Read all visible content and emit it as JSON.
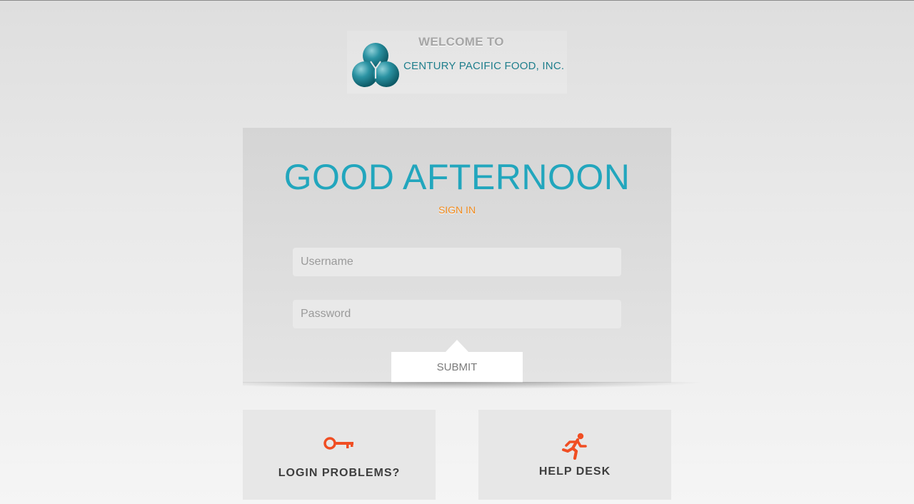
{
  "logo": {
    "welcome": "WELCOME TO",
    "company": "CENTURY PACIFIC FOOD, INC.",
    "icon": "three-circles-logo"
  },
  "login": {
    "greeting": "GOOD AFTERNOON",
    "sign_in": "SIGN IN",
    "username_placeholder": "Username",
    "username_value": "",
    "password_placeholder": "Password",
    "password_value": "",
    "submit_label": "SUBMIT"
  },
  "tiles": [
    {
      "label": "LOGIN PROBLEMS?",
      "icon": "key-icon"
    },
    {
      "label": "HELP DESK",
      "icon": "running-person-icon"
    }
  ],
  "colors": {
    "greeting": "#22a6bd",
    "sign_in": "#f08a1c",
    "tile_icon": "#f04e23",
    "logo_teal": "#1e7e8c"
  }
}
